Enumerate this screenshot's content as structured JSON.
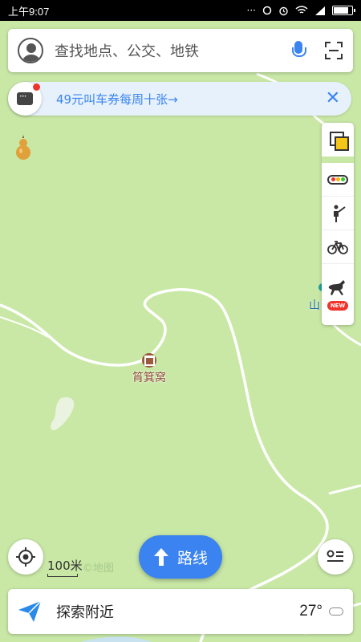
{
  "status_bar": {
    "time": "上午9:07",
    "indicators": "···"
  },
  "search": {
    "placeholder": "查找地点、公交、地铁",
    "avatar_icon": "user-avatar-icon",
    "mic_icon": "microphone-icon",
    "scan_icon": "scan-icon"
  },
  "promo": {
    "text": "49元叫车券每周十张→",
    "close": "✕",
    "has_unread_dot": true
  },
  "toolbar": {
    "items": [
      "layers-icon",
      "traffic-icon",
      "panorama-icon",
      "bike-icon",
      "horse-icon"
    ],
    "new_badge": "NEW"
  },
  "map": {
    "poi_label": "筲箕窝",
    "edge_label": "山",
    "scale_label": "100米",
    "source_watermark": "©地图",
    "land_color": "#c9e8a6",
    "road_color": "#ffffff"
  },
  "route_button": {
    "label": "路线"
  },
  "bottom_bar": {
    "label": "探索附近",
    "temperature": "27°",
    "weather_icon": "cloud-icon"
  },
  "colors": {
    "accent": "#3a83f1",
    "poi": "#8a4a2e",
    "alert": "#f0342b"
  }
}
